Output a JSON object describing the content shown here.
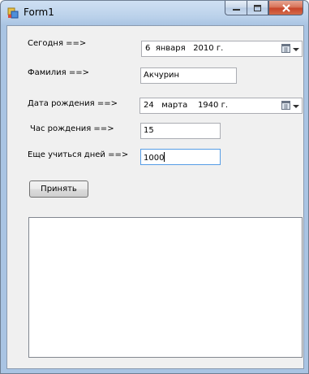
{
  "window": {
    "title": "Form1",
    "icon": "form-app-icon",
    "controls": [
      "minimize-icon",
      "maximize-icon",
      "close-icon"
    ]
  },
  "form": {
    "today": {
      "label": "Сегодня ==>",
      "value": "6  января   2010 г."
    },
    "surname": {
      "label": "Фамилия ==>",
      "value": "Акчурин"
    },
    "birth_date": {
      "label": "Дата рождения ==>",
      "value": "24   марта    1940 г."
    },
    "birth_hour": {
      "label": "Час рождения ==>",
      "value": "15"
    },
    "study_days": {
      "label": "Еще учиться дней ==>",
      "value": "1000"
    },
    "accept_button": "Принять"
  },
  "output_list": {
    "items": []
  }
}
